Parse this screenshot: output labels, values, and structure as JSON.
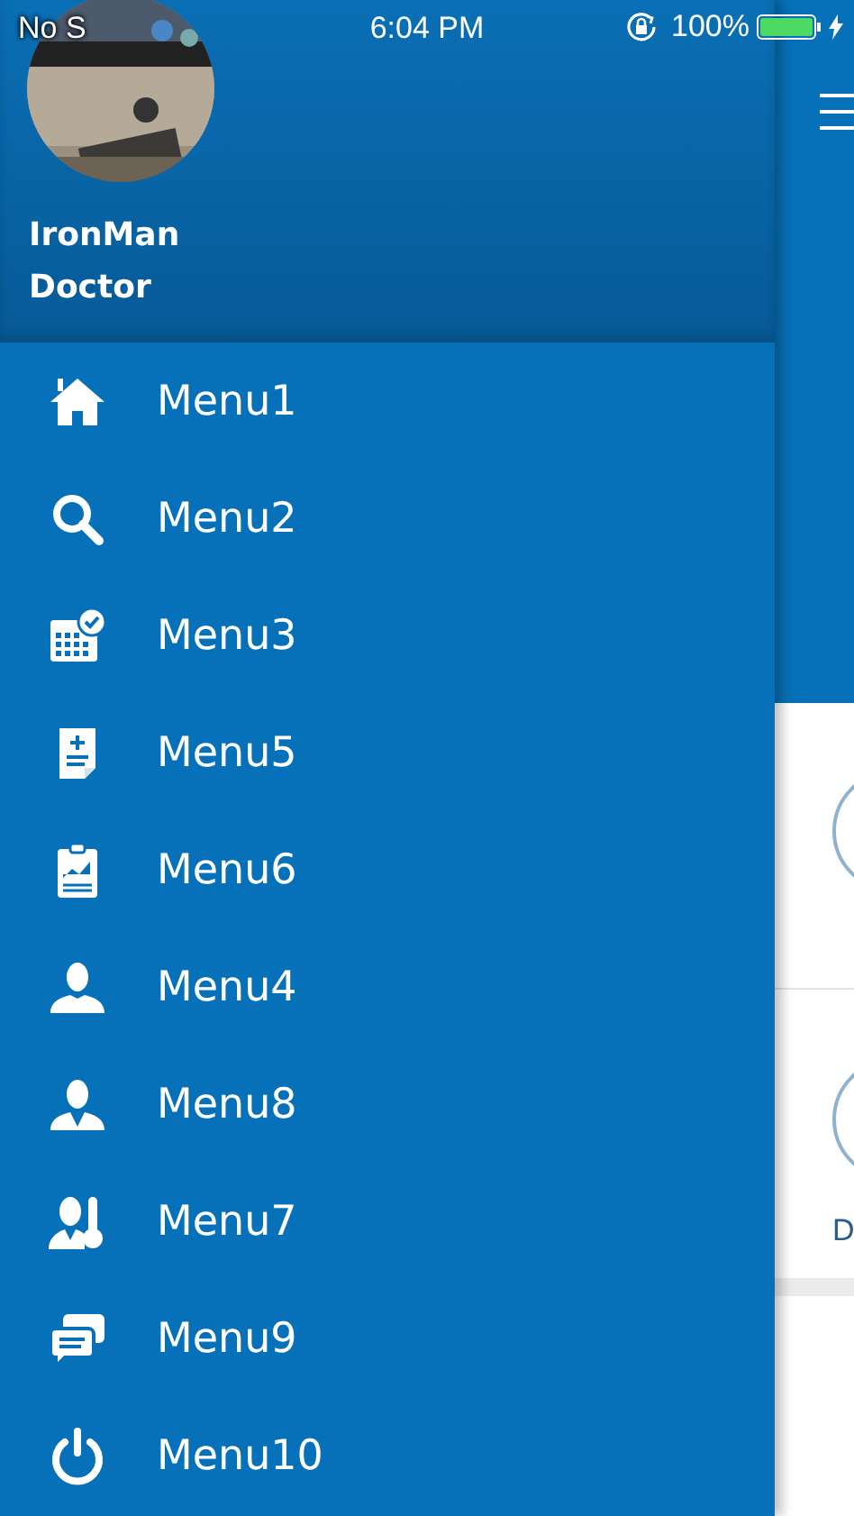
{
  "status_bar": {
    "carrier": "No S",
    "time": "6:04 PM",
    "battery": "100%",
    "charging": true
  },
  "profile": {
    "name": "IronMan",
    "role": "Doctor"
  },
  "menu": [
    {
      "label": "Menu1"
    },
    {
      "label": "Menu2"
    },
    {
      "label": "Menu3"
    },
    {
      "label": "Menu5"
    },
    {
      "label": "Menu6"
    },
    {
      "label": "Menu4"
    },
    {
      "label": "Menu8"
    },
    {
      "label": "Menu7"
    },
    {
      "label": "Menu9"
    },
    {
      "label": "Menu10"
    }
  ],
  "main": {
    "card_label": "D"
  }
}
